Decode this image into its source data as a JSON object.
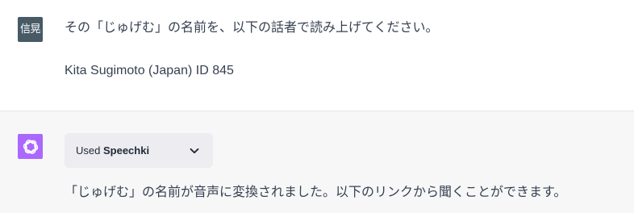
{
  "user_message": {
    "avatar_text": "信晃",
    "line1": "その「じゅげむ」の名前を、以下の話者で読み上げてください。",
    "line2": "Kita Sugimoto (Japan) ID 845"
  },
  "assistant_message": {
    "plugin": {
      "prefix": "Used",
      "name": "Speechki"
    },
    "text": "「じゅげむ」の名前が音声に変換されました。以下のリンクから聞くことができます。"
  },
  "colors": {
    "user_avatar_bg": "#475a66",
    "bot_avatar_bg": "#ab68ff",
    "assistant_bg": "#f7f7f8",
    "pill_bg": "#ececf1"
  },
  "icons": {
    "assistant_avatar": "openai-logo-icon",
    "plugin_toggle": "chevron-down-icon"
  }
}
